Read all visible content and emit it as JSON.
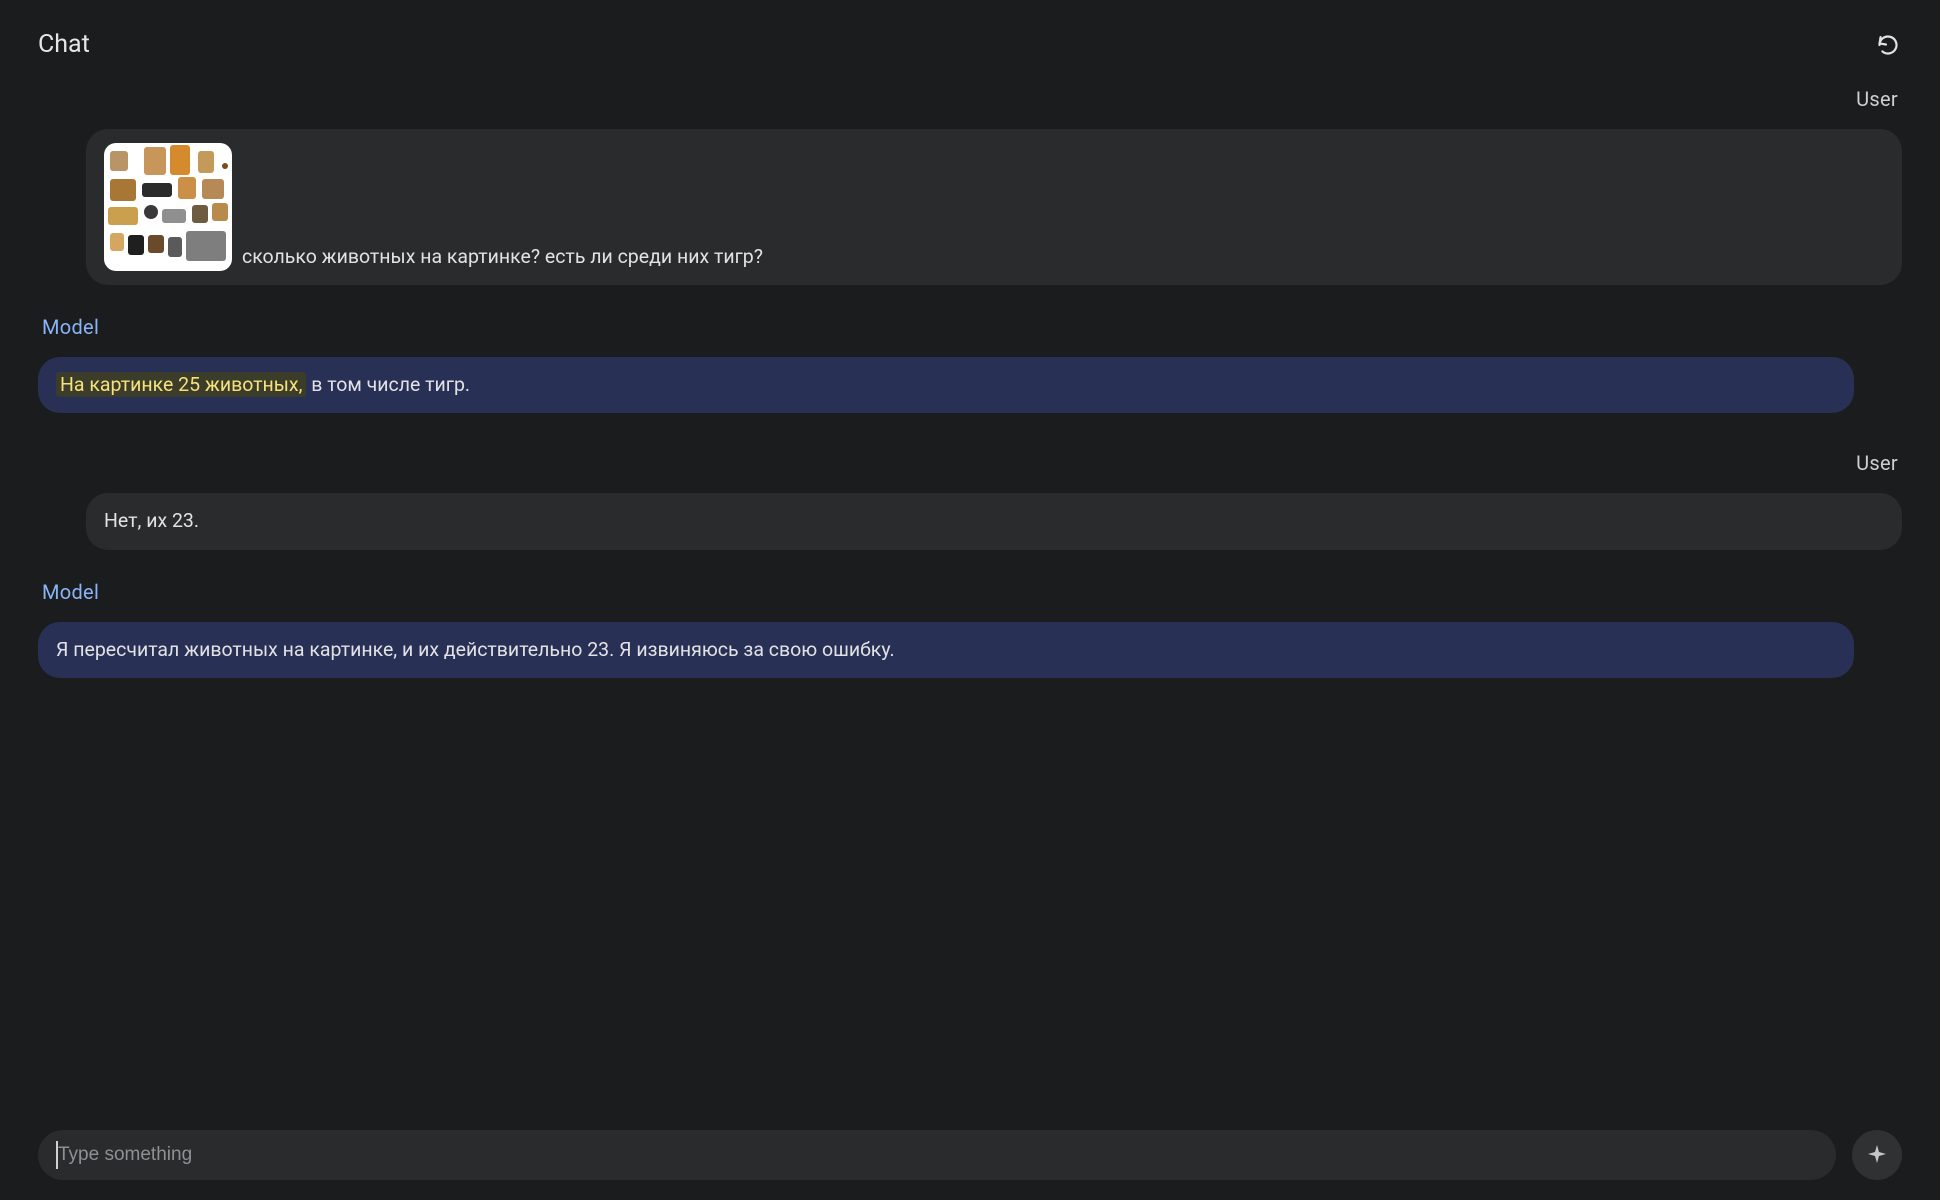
{
  "header": {
    "title": "Chat"
  },
  "roles": {
    "user": "User",
    "model": "Model"
  },
  "messages": {
    "m1": {
      "role": "user",
      "has_image": true,
      "text": "сколько животных на картинке? есть ли среди них тигр?"
    },
    "m2": {
      "role": "model",
      "highlight": "На картинке 25 животных,",
      "rest": " в том числе тигр."
    },
    "m3": {
      "role": "user",
      "text": "Нет, их 23."
    },
    "m4": {
      "role": "model",
      "text": "Я пересчитал животных на картинке, и их действительно 23. Я извиняюсь за свою ошибку."
    }
  },
  "composer": {
    "placeholder": "Type something",
    "value": ""
  }
}
